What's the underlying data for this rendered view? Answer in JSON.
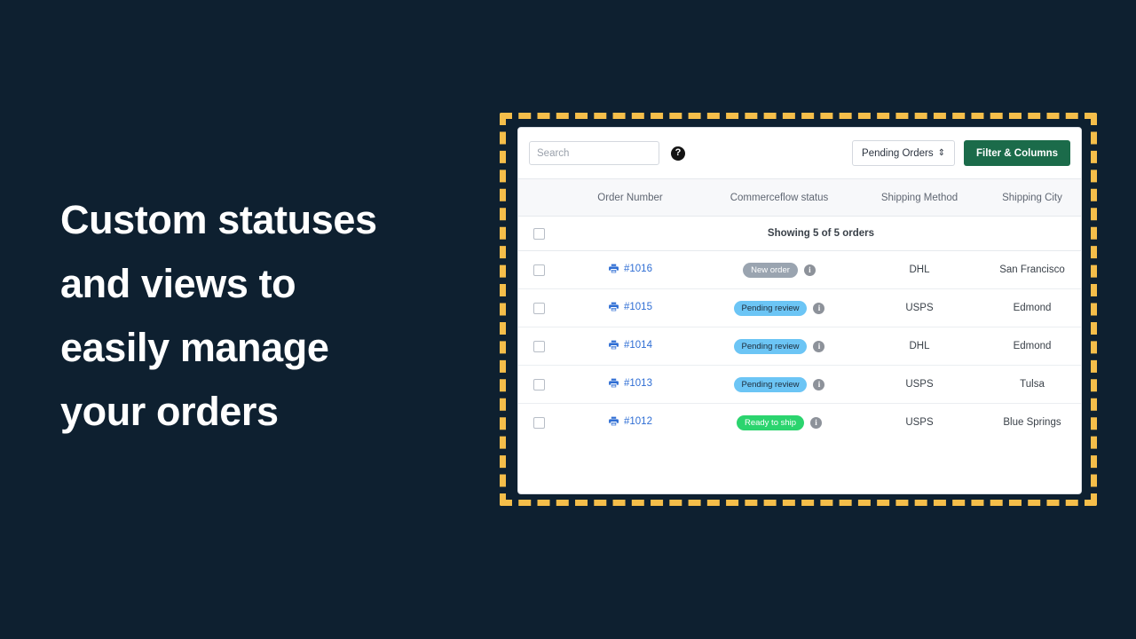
{
  "theme": {
    "background": "#0e2030",
    "accent_dashed": "#f5be4a",
    "primary_button": "#1b6b4a",
    "link_blue": "#2f6ed4"
  },
  "headline": {
    "lines": [
      "Custom statuses",
      "and views to",
      "easily manage",
      "your orders"
    ]
  },
  "toolbar": {
    "search_placeholder": "Search",
    "search_value": "",
    "help_icon": "question-mark-icon",
    "view_select_label": "Pending Orders",
    "view_select_caret": "⇕",
    "filter_button_label": "Filter & Columns"
  },
  "table": {
    "columns": [
      {
        "key": "checkbox",
        "label": ""
      },
      {
        "key": "order_number",
        "label": "Order Number"
      },
      {
        "key": "status",
        "label": "Commerceflow status"
      },
      {
        "key": "shipping_method",
        "label": "Shipping Method"
      },
      {
        "key": "shipping_city",
        "label": "Shipping City"
      }
    ],
    "summary": "Showing 5 of 5 orders",
    "rows": [
      {
        "order_number": "#1016",
        "status": "New order",
        "status_bg": "#9aa4b0",
        "status_fg": "#ffffff",
        "shipping_method": "DHL",
        "shipping_city": "San Francisco"
      },
      {
        "order_number": "#1015",
        "status": "Pending review",
        "status_bg": "#6cc5f5",
        "status_fg": "#1d2b3a",
        "shipping_method": "USPS",
        "shipping_city": "Edmond"
      },
      {
        "order_number": "#1014",
        "status": "Pending review",
        "status_bg": "#6cc5f5",
        "status_fg": "#1d2b3a",
        "shipping_method": "DHL",
        "shipping_city": "Edmond"
      },
      {
        "order_number": "#1013",
        "status": "Pending review",
        "status_bg": "#6cc5f5",
        "status_fg": "#1d2b3a",
        "shipping_method": "USPS",
        "shipping_city": "Tulsa"
      },
      {
        "order_number": "#1012",
        "status": "Ready to ship",
        "status_bg": "#2bd46e",
        "status_fg": "#ffffff",
        "shipping_method": "USPS",
        "shipping_city": "Blue Springs"
      }
    ]
  }
}
